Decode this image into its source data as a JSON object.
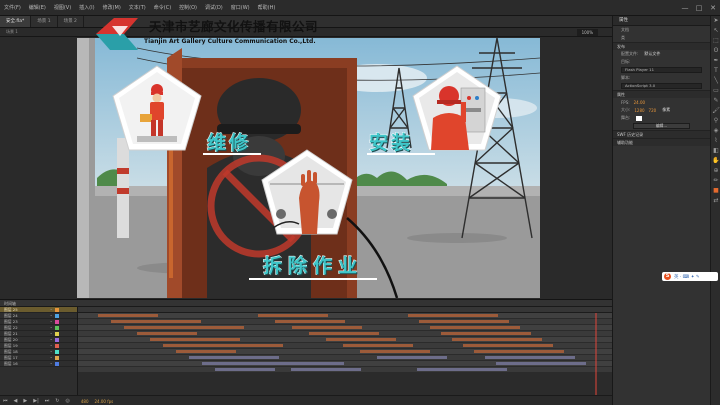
{
  "logo": {
    "company_cn": "天津市艺廊文化传播有限公司",
    "company_en": "Tianjin Art Gallery Culture Communication Co.,Ltd."
  },
  "menu": {
    "items": [
      "文件(F)",
      "编辑(E)",
      "视图(V)",
      "插入(I)",
      "修改(M)",
      "文本(T)",
      "命令(C)",
      "控制(O)",
      "调试(D)",
      "窗口(W)",
      "帮助(H)"
    ],
    "minimize": "—",
    "maximize": "□",
    "close": "✕"
  },
  "tabs": [
    "安全.fla*",
    "场景 1",
    "场景 2"
  ],
  "editbar": {
    "scene": "场景 1",
    "zoom": "100%"
  },
  "stage_labels": {
    "weixiu": "维修",
    "anzhuang": "安装",
    "chaichu": "拆除作业"
  },
  "properties": {
    "header": "属性",
    "doc_type": "文档",
    "class_label": "类",
    "section_publish": "发布",
    "profile_label": "配置文件:",
    "profile_value": "默认文件",
    "target_label": "目标:",
    "target_value": "Flash Player 11",
    "script_label": "脚本:",
    "script_value": "ActionScript 3.0",
    "section_props": "属性",
    "fps_label": "FPS:",
    "fps_value": "24.00",
    "size_label": "大小:",
    "width": "1280",
    "height": "720",
    "px": "像素",
    "stage_label": "舞台:",
    "edit_button": "编辑...",
    "section_swf": "SWF 历史记录",
    "section_aux": "辅助功能"
  },
  "timeline": {
    "header": "时间轴",
    "layers": [
      {
        "name": "图层 25",
        "color": "#e8963a",
        "selected": true
      },
      {
        "name": "图层 24",
        "color": "#4fa3e0",
        "selected": false
      },
      {
        "name": "图层 23",
        "color": "#d84a9c",
        "selected": false
      },
      {
        "name": "图层 22",
        "color": "#5cc35c",
        "selected": false
      },
      {
        "name": "图层 21",
        "color": "#e0d04f",
        "selected": false
      },
      {
        "name": "图层 20",
        "color": "#9a6be0",
        "selected": false
      },
      {
        "name": "图层 19",
        "color": "#e05f4f",
        "selected": false
      },
      {
        "name": "图层 18",
        "color": "#4fe0c8",
        "selected": false
      },
      {
        "name": "图层 17",
        "color": "#e0a84f",
        "selected": false
      },
      {
        "name": "图层 16",
        "color": "#4f7ce0",
        "selected": false
      }
    ],
    "current_frame": "480",
    "fps": "24.00 fps"
  },
  "ime": {
    "logo": "S",
    "text": "英 · ⌨ ✦ ✎"
  },
  "colors": {
    "label_fill": "#3fc6c9",
    "logo_red": "#d6342f",
    "logo_teal": "#2a9fa8",
    "worker_red": "#e0452c"
  }
}
